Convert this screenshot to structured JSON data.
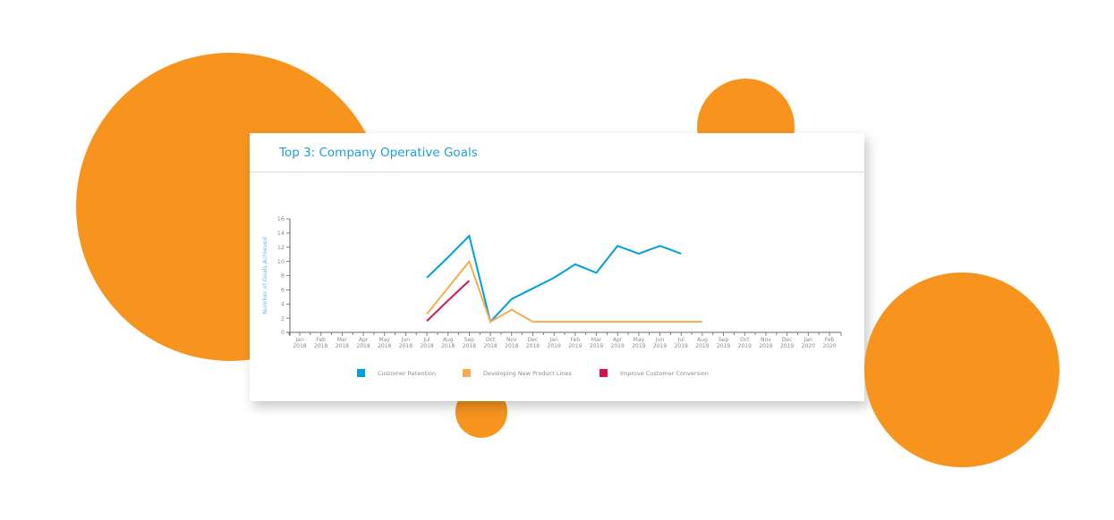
{
  "card": {
    "title": "Top 3: Company Operative Goals"
  },
  "colors": {
    "accent_orange": "#f7941e",
    "title_blue": "#1ea0d6"
  },
  "chart_data": {
    "type": "line",
    "title": "Top 3: Company Operative Goals",
    "xlabel": "",
    "ylabel": "Number of Goals Achieved",
    "ylim": [
      0,
      16
    ],
    "yticks": [
      0,
      2,
      4,
      6,
      8,
      10,
      12,
      14,
      16
    ],
    "grid": false,
    "legend_position": "bottom",
    "categories": [
      [
        "Jan",
        "2018"
      ],
      [
        "Feb",
        "2018"
      ],
      [
        "Mar",
        "2018"
      ],
      [
        "Apr",
        "2018"
      ],
      [
        "May",
        "2018"
      ],
      [
        "Jun",
        "2018"
      ],
      [
        "Jul",
        "2018"
      ],
      [
        "Aug",
        "2018"
      ],
      [
        "Sep",
        "2018"
      ],
      [
        "Oct",
        "2018"
      ],
      [
        "Nov",
        "2018"
      ],
      [
        "Dec",
        "2018"
      ],
      [
        "Jan",
        "2019"
      ],
      [
        "Feb",
        "2019"
      ],
      [
        "Mar",
        "2019"
      ],
      [
        "Apr",
        "2019"
      ],
      [
        "May",
        "2019"
      ],
      [
        "Jun",
        "2019"
      ],
      [
        "Jul",
        "2019"
      ],
      [
        "Aug",
        "2019"
      ],
      [
        "Sep",
        "2019"
      ],
      [
        "Oct",
        "2019"
      ],
      [
        "Nov",
        "2019"
      ],
      [
        "Dec",
        "2019"
      ],
      [
        "Jan",
        "2020"
      ],
      [
        "Feb",
        "2020"
      ]
    ],
    "series": [
      {
        "name": "Customer Retention",
        "color": "#009fdf",
        "values": [
          null,
          null,
          null,
          null,
          null,
          null,
          7.7,
          10.6,
          13.6,
          1.5,
          4.7,
          6.2,
          7.7,
          9.6,
          8.4,
          12.2,
          11.1,
          12.2,
          11.1,
          null,
          null,
          null,
          null,
          null,
          null,
          null
        ]
      },
      {
        "name": "Developing New Product Lines",
        "color": "#f4ac4f",
        "values": [
          null,
          null,
          null,
          null,
          null,
          null,
          2.6,
          6.3,
          10.0,
          1.5,
          3.2,
          1.5,
          1.5,
          1.5,
          1.5,
          1.5,
          1.5,
          1.5,
          1.5,
          1.5,
          null,
          null,
          null,
          null,
          null,
          null
        ]
      },
      {
        "name": "Improve Customer Conversion",
        "color": "#d2144a",
        "values": [
          null,
          null,
          null,
          null,
          null,
          null,
          1.6,
          4.5,
          7.3,
          null,
          null,
          null,
          null,
          null,
          null,
          null,
          null,
          null,
          null,
          null,
          null,
          null,
          null,
          null,
          null,
          null
        ]
      }
    ]
  }
}
